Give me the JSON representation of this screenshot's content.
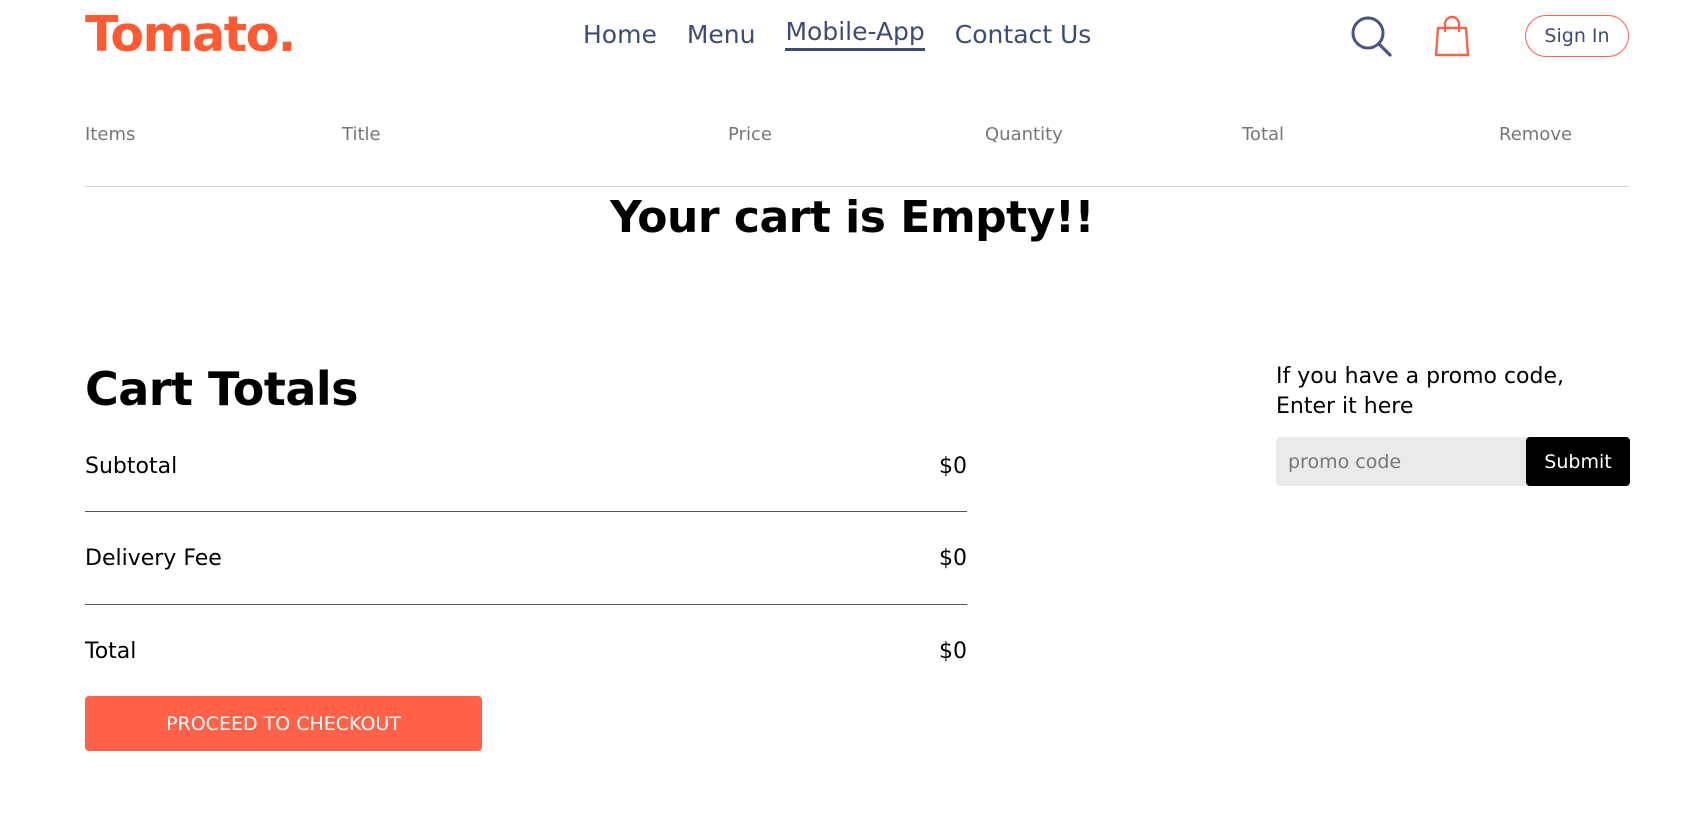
{
  "brand": {
    "logo": "Tomato.",
    "accent_color": "#ff6248",
    "nav_color": "#3e4b73"
  },
  "nav": {
    "links": [
      {
        "label": "Home",
        "active": false
      },
      {
        "label": "Menu",
        "active": false
      },
      {
        "label": "Mobile-App",
        "active": true
      },
      {
        "label": "Contact Us",
        "active": false
      }
    ],
    "search_icon": "search-icon",
    "cart_icon": "shopping-bag-icon",
    "sign_in_label": "Sign In"
  },
  "cart": {
    "columns": [
      "Items",
      "Title",
      "Price",
      "Quantity",
      "Total",
      "Remove"
    ],
    "empty_message": "Your cart is Empty!!"
  },
  "totals": {
    "title": "Cart Totals",
    "rows": [
      {
        "label": "Subtotal",
        "value": "$0"
      },
      {
        "label": "Delivery Fee",
        "value": "$0"
      },
      {
        "label": "Total",
        "value": "$0"
      }
    ],
    "checkout_label": "PROCEED TO CHECKOUT"
  },
  "promo": {
    "prompt": "If you have a promo code, Enter it here",
    "placeholder": "promo code",
    "value": "",
    "submit_label": "Submit"
  }
}
